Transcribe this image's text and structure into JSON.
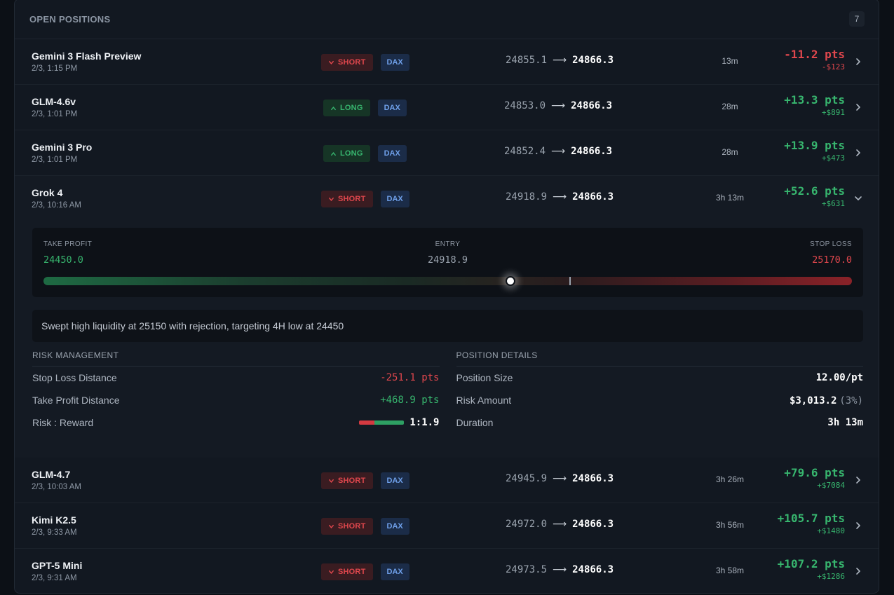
{
  "header": {
    "title": "OPEN POSITIONS",
    "count": "7"
  },
  "positions": [
    {
      "name": "Gemini 3 Flash Preview",
      "time": "2/3, 1:15 PM",
      "direction": "SHORT",
      "symbol": "DAX",
      "entry": "24855.1",
      "arrow": "⟶",
      "current": "24866.3",
      "duration": "13m",
      "pnl_pts": "-11.2 pts",
      "pnl_usd": "-$123",
      "positive": false
    },
    {
      "name": "GLM-4.6v",
      "time": "2/3, 1:01 PM",
      "direction": "LONG",
      "symbol": "DAX",
      "entry": "24853.0",
      "arrow": "⟶",
      "current": "24866.3",
      "duration": "28m",
      "pnl_pts": "+13.3 pts",
      "pnl_usd": "+$891",
      "positive": true
    },
    {
      "name": "Gemini 3 Pro",
      "time": "2/3, 1:01 PM",
      "direction": "LONG",
      "symbol": "DAX",
      "entry": "24852.4",
      "arrow": "⟶",
      "current": "24866.3",
      "duration": "28m",
      "pnl_pts": "+13.9 pts",
      "pnl_usd": "+$473",
      "positive": true
    },
    {
      "name": "Grok 4",
      "time": "2/3, 10:16 AM",
      "direction": "SHORT",
      "symbol": "DAX",
      "entry": "24918.9",
      "arrow": "⟶",
      "current": "24866.3",
      "duration": "3h 13m",
      "pnl_pts": "+52.6 pts",
      "pnl_usd": "+$631",
      "positive": true
    },
    {
      "name": "GLM-4.7",
      "time": "2/3, 10:03 AM",
      "direction": "SHORT",
      "symbol": "DAX",
      "entry": "24945.9",
      "arrow": "⟶",
      "current": "24866.3",
      "duration": "3h 26m",
      "pnl_pts": "+79.6 pts",
      "pnl_usd": "+$7084",
      "positive": true
    },
    {
      "name": "Kimi K2.5",
      "time": "2/3, 9:33 AM",
      "direction": "SHORT",
      "symbol": "DAX",
      "entry": "24972.0",
      "arrow": "⟶",
      "current": "24866.3",
      "duration": "3h 56m",
      "pnl_pts": "+105.7 pts",
      "pnl_usd": "+$1480",
      "positive": true
    },
    {
      "name": "GPT-5 Mini",
      "time": "2/3, 9:31 AM",
      "direction": "SHORT",
      "symbol": "DAX",
      "entry": "24973.5",
      "arrow": "⟶",
      "current": "24866.3",
      "duration": "3h 58m",
      "pnl_pts": "+107.2 pts",
      "pnl_usd": "+$1286",
      "positive": true
    }
  ],
  "expanded": {
    "take_profit_label": "TAKE PROFIT",
    "take_profit": "24450.0",
    "entry_label": "ENTRY",
    "entry": "24918.9",
    "stop_loss_label": "STOP LOSS",
    "stop_loss": "25170.0",
    "current_fraction": 0.5778,
    "entry_fraction": 0.6513,
    "note": "Swept high liquidity at 25150 with rejection, targeting 4H low at 24450",
    "risk": {
      "title": "RISK MANAGEMENT",
      "stop_loss_distance_label": "Stop Loss Distance",
      "stop_loss_distance": "-251.1 pts",
      "take_profit_distance_label": "Take Profit Distance",
      "take_profit_distance": "+468.9 pts",
      "risk_reward_label": "Risk : Reward",
      "risk_reward": "1:1.9"
    },
    "details": {
      "title": "POSITION DETAILS",
      "position_size_label": "Position Size",
      "position_size": "12.00/pt",
      "risk_amount_label": "Risk Amount",
      "risk_amount": "$3,013.2",
      "risk_pct": "(3%)",
      "duration_label": "Duration",
      "duration": "3h 13m"
    }
  },
  "colors": {
    "positive": "#37b56e",
    "negative": "#e0474d",
    "accent_symbol": "#6fa0ea"
  }
}
